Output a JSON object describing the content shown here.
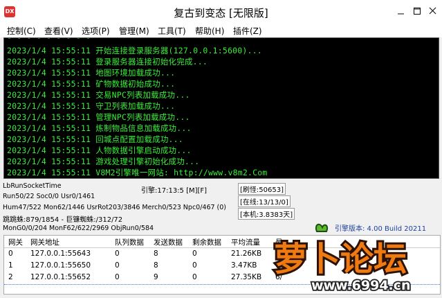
{
  "window": {
    "title": "复古到变态 [无限版]",
    "icon_text": "DX"
  },
  "menu": [
    "控制(C)",
    "查看(V)",
    "选项(P)",
    "管理(M)",
    "工具(T)",
    "帮助(H)",
    "插件(Z)"
  ],
  "log": [
    "2023/1/4 15:55:11 开始连接登录服务器(127.0.0.1:5600)...",
    "2023/1/4 15:55:11 登录服务器连接初始化完成...",
    "2023/1/4 15:55:11 地图环境加载成功...",
    "2023/1/4 15:55:11 矿物数据初始成功...",
    "2023/1/4 15:55:11 交易NPC列表加载成功...",
    "2023/1/4 15:55:11 守卫列表加载成功...",
    "2023/1/4 15:55:11 管理NPC列表加载成功...",
    "2023/1/4 15:55:11 炼制物品信息加载成功...",
    "2023/1/4 15:55:11 回城点配置加载成功...",
    "2023/1/4 15:55:11 人物数据引擎启动成功...",
    "2023/1/4 15:55:11 游戏处理引擎初始化成功...",
    "2023/1/4 15:55:11 V8M2引擎唯一网站: http://www.v8m2.Com"
  ],
  "stats": {
    "socket": "LbRunSocketTime",
    "engine": "引擎:17:13:5 [M][F]",
    "refresh": "[刷怪:50653]",
    "run": "Run50/22 Soc0/0 Usr0/1461",
    "online": "[在线:13/13/0]",
    "hum": "Hum47/522 Mon62/1446 UsrRot203/3846 Merch0/523 Npc0/467 (0)",
    "machine": "[本机:3.8383天]",
    "spider": "跳跳蛛:879/1854 - 巨镰蜘蛛:/312/72",
    "version": "引擎版本: 4.00 Build 20211",
    "mong": "MonG0/0/204 MonF62/622/2969 ObjRun0/584"
  },
  "table": {
    "headers": [
      "网关",
      "网关地址",
      "队列数据",
      "发送数据",
      "剩余数据",
      "平均流量",
      "最"
    ],
    "rows": [
      [
        "0",
        "127.0.0.1:55643",
        "0",
        "8",
        "0",
        "21.26KB",
        ""
      ],
      [
        "1",
        "127.0.0.1:55650",
        "0",
        "8",
        "0",
        "3.47KB",
        ""
      ],
      [
        "2",
        "127.0.0.1:55652",
        "0",
        "9",
        "0",
        "27.35KB",
        "6/"
      ]
    ]
  },
  "watermark": {
    "title": "萝卜论坛",
    "url": "www.6994.cn"
  }
}
